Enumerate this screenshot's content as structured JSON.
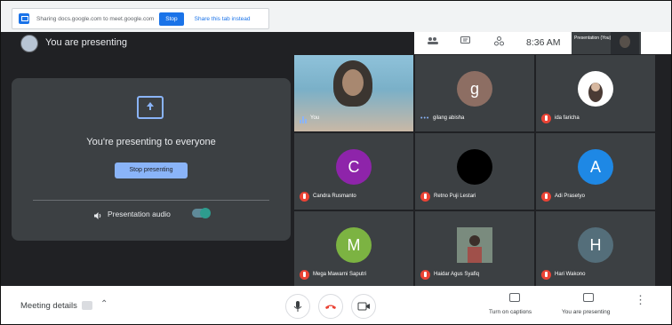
{
  "share_bar": {
    "text": "Sharing docs.google.com to meet.google.com",
    "stop_label": "Stop",
    "share_this_label": "Share this tab instead"
  },
  "top_bar": {
    "title": "You are presenting",
    "time": "8:36 AM",
    "presentation_label": "Presentation (You)"
  },
  "present_card": {
    "message": "You're presenting to everyone",
    "stop_label": "Stop presenting",
    "audio_label": "Presentation audio",
    "audio_on": true
  },
  "participants": [
    {
      "name": "You",
      "kind": "video",
      "speaking": true
    },
    {
      "name": "gilang abisha",
      "initial": "g",
      "color": "#8d6e63",
      "status": "more"
    },
    {
      "name": "ida faricha",
      "kind": "photo",
      "color": "#ffffff",
      "muted": true
    },
    {
      "name": "Candra Rusmanto",
      "initial": "C",
      "color": "#8e24aa",
      "muted": true
    },
    {
      "name": "Retno Puji Lestari",
      "kind": "photo",
      "color": "#000000",
      "muted": true
    },
    {
      "name": "Adi Prasetyo",
      "initial": "A",
      "color": "#1e88e5",
      "muted": true
    },
    {
      "name": "Mega Mawarni Saputri",
      "initial": "M",
      "color": "#7cb342",
      "muted": true
    },
    {
      "name": "Haidar Agus Syafiq",
      "kind": "photo",
      "color": "#6d5b57",
      "muted": true
    },
    {
      "name": "Hari Wakono",
      "initial": "H",
      "color": "#546e7a",
      "muted": true
    }
  ],
  "bottom_bar": {
    "meeting_details": "Meeting details",
    "captions_label": "Turn on captions",
    "presenting_label": "You are presenting"
  }
}
